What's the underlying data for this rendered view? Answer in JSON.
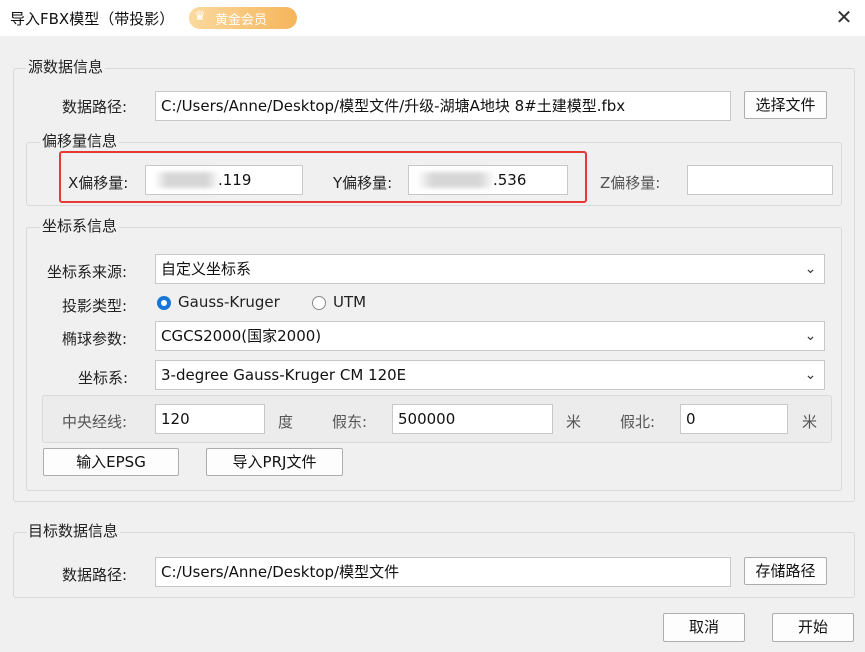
{
  "window": {
    "title": "导入FBX模型（带投影）",
    "vip_label": "黄金会员",
    "crown_icon": "♛",
    "close_glyph": "✕"
  },
  "source": {
    "title": "源数据信息",
    "path_label": "数据路径:",
    "path_value": "C:/Users/Anne/Desktop/模型文件/升级-湖塘A地块 8#土建模型.fbx",
    "choose_button": "选择文件"
  },
  "offset": {
    "title": "偏移量信息",
    "x_label": "X偏移量:",
    "x_value": ".119",
    "y_label": "Y偏移量:",
    "y_value": ".536",
    "z_label": "Z偏移量:",
    "z_value": ""
  },
  "crs": {
    "title": "坐标系信息",
    "source_label": "坐标系来源:",
    "source_value": "自定义坐标系",
    "projection_label": "投影类型:",
    "projection_options": [
      "Gauss-Kruger",
      "UTM"
    ],
    "ellipsoid_label": "椭球参数:",
    "ellipsoid_value": "CGCS2000(国家2000)",
    "system_label": "坐标系:",
    "system_value": "3-degree Gauss-Kruger CM 120E",
    "central_meridian_label": "中央经线:",
    "central_meridian_value": "120",
    "degree_unit": "度",
    "false_east_label": "假东:",
    "false_east_value": "500000",
    "meter_unit_east": "米",
    "false_north_label": "假北:",
    "false_north_value": "0",
    "meter_unit_north": "米",
    "epsg_button": "输入EPSG",
    "prj_button": "导入PRJ文件",
    "dropdown_glyph": "⌄"
  },
  "target": {
    "title": "目标数据信息",
    "path_label": "数据路径:",
    "path_value": "C:/Users/Anne/Desktop/模型文件",
    "save_button": "存储路径"
  },
  "footer": {
    "cancel": "取消",
    "start": "开始"
  },
  "colors": {
    "accent": "#1677d8",
    "highlight": "#e53935",
    "vip": "#f6b55a"
  }
}
